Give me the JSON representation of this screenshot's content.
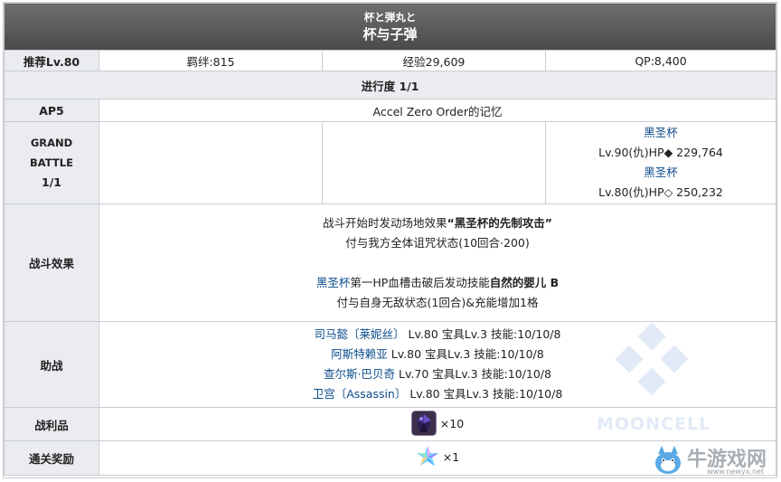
{
  "header": {
    "subtitle": "杯と弾丸と",
    "title": "杯与子弹"
  },
  "row_level": {
    "label": "推荐Lv.80",
    "bond": "羁绊:815",
    "exp": "经验29,609",
    "qp": "QP:8,400"
  },
  "progress": {
    "label": "进行度 1/1"
  },
  "row_ap": {
    "label": "AP5",
    "location": "Accel Zero Order的记忆"
  },
  "battle": {
    "label_lines": [
      "GRAND",
      "BATTLE",
      "1/1"
    ],
    "enemies": [
      {
        "name": "黑圣杯",
        "stats": "Lv.90(仇)HP◆ 229,764"
      },
      {
        "name": "黑圣杯",
        "stats": "Lv.80(仇)HP◇ 250,232"
      }
    ]
  },
  "effects": {
    "label": "战斗效果",
    "line1_prefix": "战斗开始时发动场地效果",
    "line1_bold": "“黑圣杯的先制攻击”",
    "line2": "付与我方全体诅咒状态(10回合·200)",
    "line3_link": "黑圣杯",
    "line3_mid": "第一HP血槽击破后发动技能",
    "line3_bold": "自然的婴儿 B",
    "line4": "付与自身无敌状态(1回合)&充能增加1格"
  },
  "support": {
    "label": "助战",
    "items": [
      {
        "name": "司马懿〔莱妮丝〕",
        "info": " Lv.80 宝具Lv.3 技能:10/10/8"
      },
      {
        "name": "阿斯特赖亚",
        "info": " Lv.80 宝具Lv.3 技能:10/10/8"
      },
      {
        "name": "查尔斯·巴贝奇",
        "info": " Lv.70 宝具Lv.3 技能:10/10/8"
      },
      {
        "name": "卫宫〔Assassin〕",
        "info": " Lv.80 宝具Lv.3 技能:10/10/8"
      }
    ]
  },
  "drops": {
    "label": "战利品",
    "count": "×10"
  },
  "reward": {
    "label": "通关奖励",
    "count": "×1"
  },
  "watermark": {
    "logo": "MOONCELL",
    "site_cn": "牛游戏网",
    "site_en": "www.newyx.net"
  }
}
